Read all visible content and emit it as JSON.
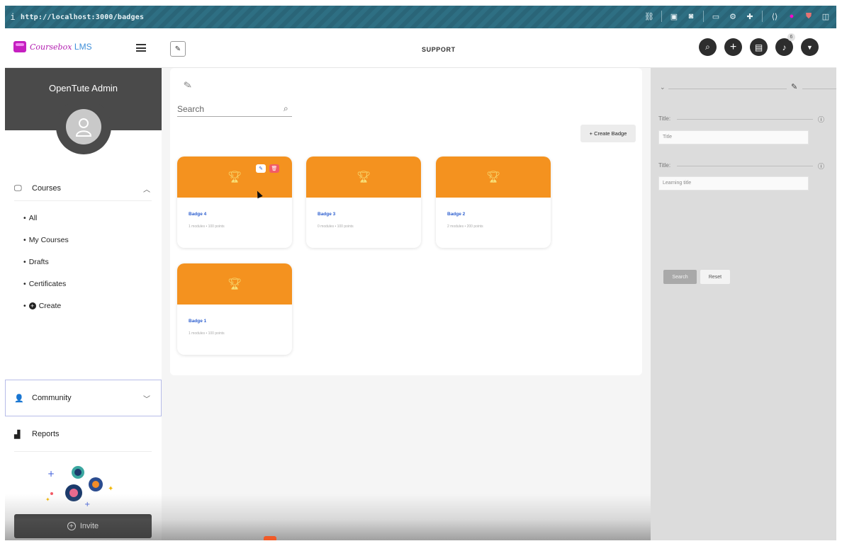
{
  "browser": {
    "info_glyph": "i",
    "url": "http://localhost:3000/badges"
  },
  "header": {
    "logo_name": "Coursebox",
    "logo_suffix": "LMS",
    "center_title": "SUPPORT",
    "notification_count": "6"
  },
  "sidebar": {
    "profile_name": "OpenTute Admin",
    "courses_label": "Courses",
    "course_items": [
      "All",
      "My Courses",
      "Drafts",
      "Certificates",
      "Create"
    ],
    "community_label": "Community",
    "reports_label": "Reports",
    "invite_label": "Invite"
  },
  "main": {
    "search_placeholder": "Search",
    "create_button": "+ Create Badge",
    "badges": [
      {
        "name": "Badge 4",
        "meta": "1 modules  •  100 points"
      },
      {
        "name": "Badge 3",
        "meta": "0 modules  •  100 points"
      },
      {
        "name": "Badge 2",
        "meta": "2 modules  •  200 points"
      },
      {
        "name": "Badge 1",
        "meta": "1 modules  •  100 points"
      }
    ]
  },
  "filter_panel": {
    "field1_label": "Title:",
    "field1_placeholder": "Title",
    "field2_label": "Title:",
    "field2_placeholder": "Learning title",
    "search_button": "Search",
    "reset_button": "Reset"
  },
  "colors": {
    "accent_orange": "#f4921f",
    "brand_magenta": "#c51fc0",
    "browser_teal": "#2e6f83",
    "badge_link_blue": "#2d5fcf",
    "delete_red": "#f25b66"
  }
}
